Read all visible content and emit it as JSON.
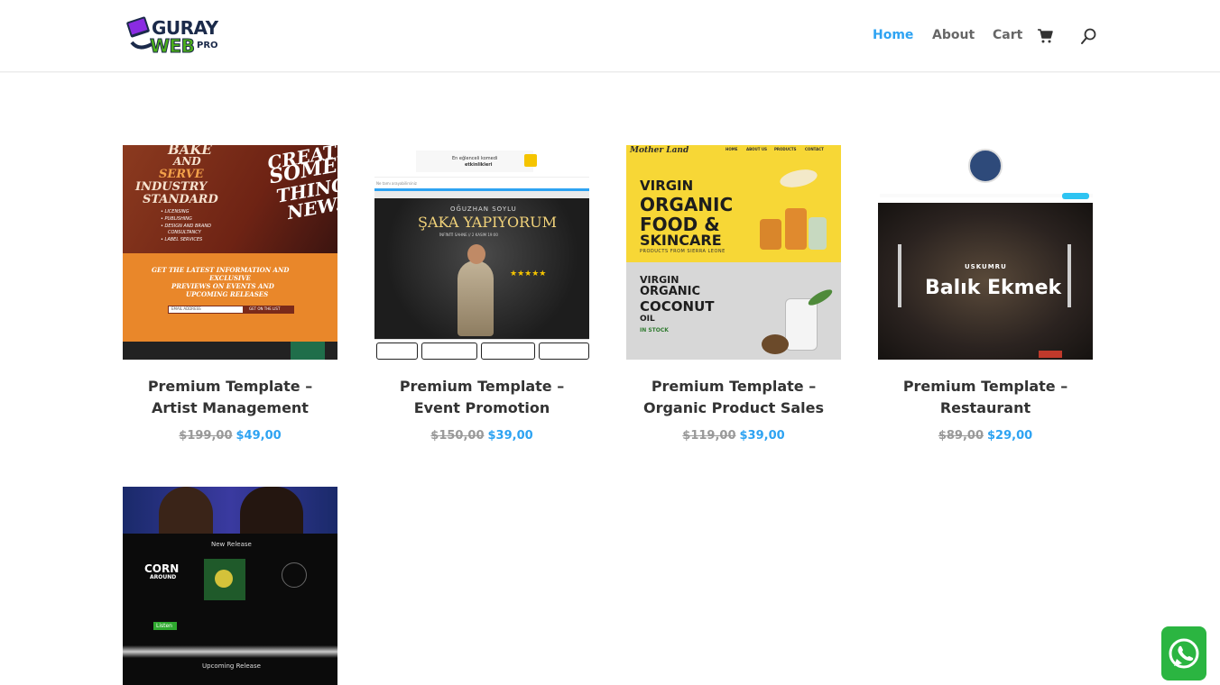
{
  "header": {
    "logo_text_top": "GURAY",
    "logo_text_bottom": "WEB",
    "logo_text_pro": "PRO",
    "nav": {
      "home": "Home",
      "about": "About",
      "cart": "Cart"
    }
  },
  "colors": {
    "accent": "#2ea3f2",
    "nav_text": "#666666",
    "title_text": "#333333",
    "old_price": "#999999",
    "whatsapp": "#25d366"
  },
  "icons": {
    "cart": "cart-icon",
    "search": "search-icon",
    "whatsapp": "whatsapp-icon"
  },
  "products": [
    {
      "title": "Premium Template – Artist Management",
      "old_price": "$199,00",
      "price": "$49,00",
      "thumb": {
        "l1": "BAKE",
        "l2": "AND",
        "l3": "SERVE",
        "l4": "INDUSTRY",
        "l5": "STANDARD",
        "b1": "• LICENSING",
        "b2": "• PUBLISHING",
        "b3": "• DESIGN AND BRAND",
        "b4": "CONSULTANCY",
        "b5": "• LABEL SERVICES",
        "brush1": "CREATE",
        "brush2": "SOME",
        "brush3": "THING",
        "brush4": "NEW.",
        "cta1": "GET THE LATEST INFORMATION AND",
        "cta2": "EXCLUSIVE",
        "cta3": "PREVIEWS ON EVENTS AND",
        "cta4": "UPCOMING RELEASES",
        "email": "EMAIL ADDRESS",
        "btn": "GET ON THE LIST"
      }
    },
    {
      "title": "Premium Template – Event Promotion",
      "old_price": "$150,00",
      "price": "$39,00",
      "thumb": {
        "top1": "En eğlenceli komedi",
        "top2": "etkinlikleri",
        "search": "Ne tamı arayabilirsiniz",
        "name": "OĞUZHAN SOYLU",
        "show": "ŞAKA YAPIYORUM",
        "venue": "İNFİNİTİ SAHNE // 2 KASIM 19:00",
        "stars": "★★★★★"
      }
    },
    {
      "title": "Premium Template – Organic Product Sales",
      "old_price": "$119,00",
      "price": "$39,00",
      "thumb": {
        "brand": "Mother Land",
        "nav1": "HOME",
        "nav2": "ABOUT US",
        "nav3": "PRODUCTS",
        "nav4": "CONTACT",
        "h1": "VIRGIN",
        "h2": "ORGANIC",
        "h3": "FOOD &",
        "h4": "SKINCARE",
        "sub": "PRODUCTS FROM SIERRA LEONE",
        "c1": "VIRGIN",
        "c2": "ORGANIC",
        "c3": "COCONUT",
        "c4": "OIL",
        "stock": "IN STOCK"
      }
    },
    {
      "title": "Premium Template – Restaurant",
      "old_price": "$89,00",
      "price": "$29,00",
      "thumb": {
        "brand": "USKUMRU",
        "dish": "Balık Ekmek"
      }
    },
    {
      "title": "",
      "old_price": "",
      "price": "",
      "thumb": {
        "release": "New Release",
        "album1": "CORN",
        "album2": "AROUND",
        "listen": "Listen",
        "upcoming": "Upcoming Release"
      }
    }
  ]
}
